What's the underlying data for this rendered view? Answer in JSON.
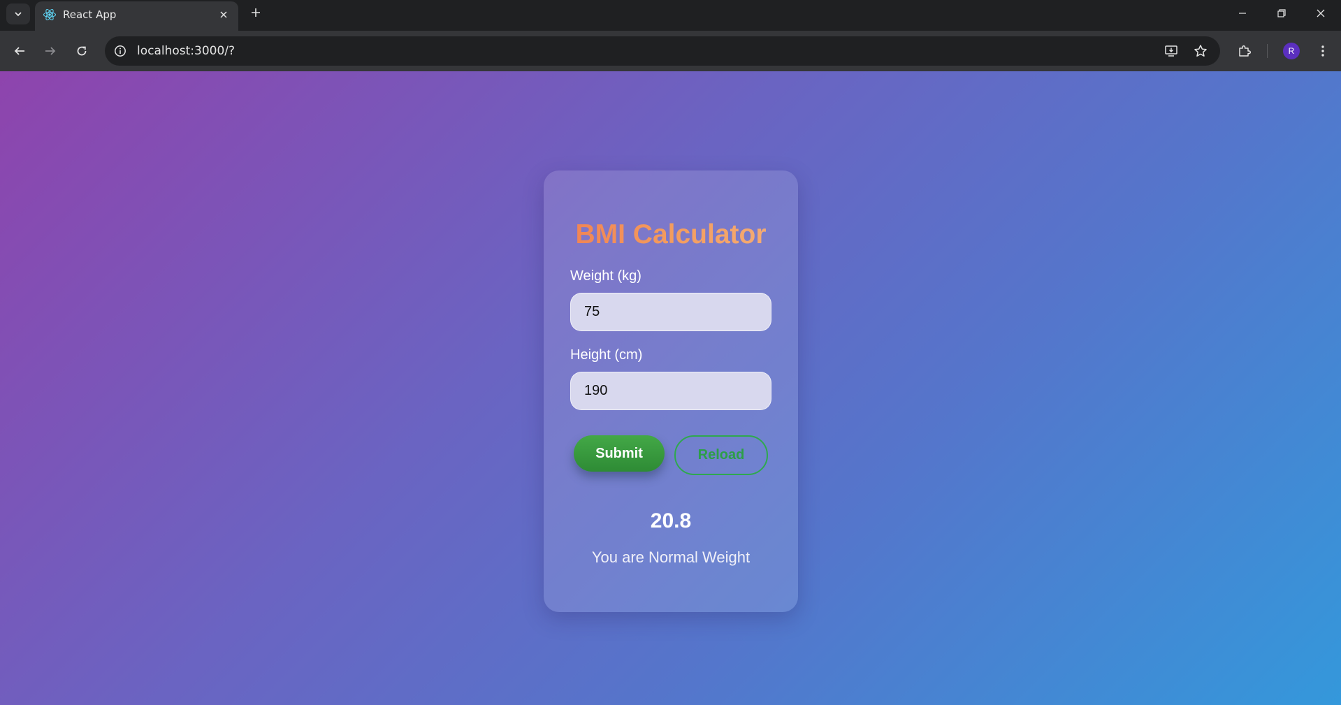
{
  "browser": {
    "tab_title": "React App",
    "url": "localhost:3000/?",
    "profile_initial": "R"
  },
  "app": {
    "title": "BMI Calculator",
    "weight": {
      "label": "Weight (kg)",
      "value": "75"
    },
    "height": {
      "label": "Height (cm)",
      "value": "190"
    },
    "submit_label": "Submit",
    "reload_label": "Reload",
    "bmi_value": "20.8",
    "bmi_message": "You are Normal Weight"
  },
  "colors": {
    "title_orange": "#f0925c",
    "submit_green": "#3a9d3f",
    "reload_green": "#2fa84e",
    "bg_gradient_start": "#8e44ad",
    "bg_gradient_end": "#3498db"
  },
  "icons": [
    "tab-search-icon",
    "react-logo-icon",
    "close-icon",
    "plus-icon",
    "minimize-icon",
    "restore-icon",
    "back-arrow-icon",
    "forward-arrow-icon",
    "reload-icon",
    "info-icon",
    "install-app-icon",
    "star-icon",
    "extensions-icon",
    "more-vert-icon"
  ]
}
